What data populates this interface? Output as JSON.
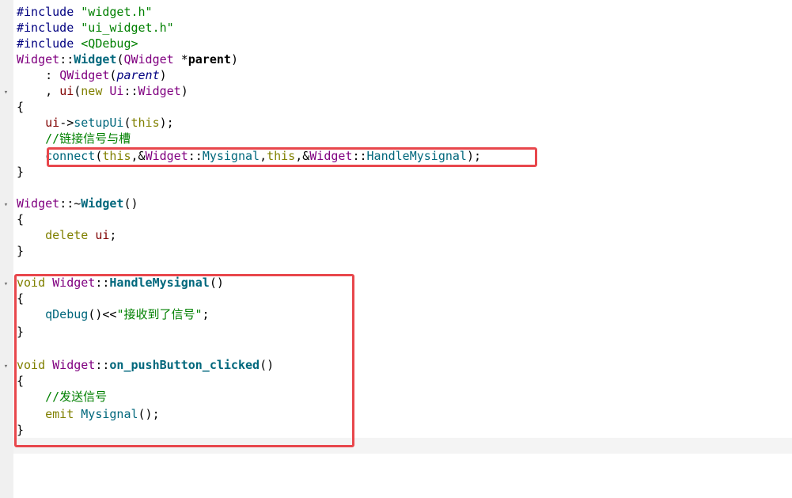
{
  "lines": [
    {
      "tokens": [
        {
          "t": "#include ",
          "c": "pp"
        },
        {
          "t": "\"widget.h\"",
          "c": "str"
        }
      ]
    },
    {
      "tokens": [
        {
          "t": "#include ",
          "c": "pp"
        },
        {
          "t": "\"ui_widget.h\"",
          "c": "str"
        }
      ]
    },
    {
      "tokens": [
        {
          "t": "#include ",
          "c": "pp"
        },
        {
          "t": "<QDebug>",
          "c": "str"
        }
      ]
    },
    {
      "tokens": [
        {
          "t": "Widget",
          "c": "cls"
        },
        {
          "t": "::",
          "c": "pl"
        },
        {
          "t": "Widget",
          "c": "fn"
        },
        {
          "t": "(",
          "c": "pl"
        },
        {
          "t": "QWidget",
          "c": "cls"
        },
        {
          "t": " *",
          "c": "pl"
        },
        {
          "t": "parent",
          "c": "bold"
        },
        {
          "t": ")",
          "c": "pl"
        }
      ]
    },
    {
      "tokens": [
        {
          "t": "    : ",
          "c": "pl"
        },
        {
          "t": "QWidget",
          "c": "cls"
        },
        {
          "t": "(",
          "c": "pl"
        },
        {
          "t": "parent",
          "c": "param"
        },
        {
          "t": ")",
          "c": "pl"
        }
      ]
    },
    {
      "fold": true,
      "tokens": [
        {
          "t": "    , ",
          "c": "pl"
        },
        {
          "t": "ui",
          "c": "mem"
        },
        {
          "t": "(",
          "c": "pl"
        },
        {
          "t": "new",
          "c": "kw"
        },
        {
          "t": " ",
          "c": "pl"
        },
        {
          "t": "Ui",
          "c": "cls"
        },
        {
          "t": "::",
          "c": "pl"
        },
        {
          "t": "Widget",
          "c": "cls"
        },
        {
          "t": ")",
          "c": "pl"
        }
      ]
    },
    {
      "tokens": [
        {
          "t": "{",
          "c": "pl"
        }
      ]
    },
    {
      "tokens": [
        {
          "t": "    ",
          "c": "pl"
        },
        {
          "t": "ui",
          "c": "mem"
        },
        {
          "t": "->",
          "c": "pl"
        },
        {
          "t": "setupUi",
          "c": "call"
        },
        {
          "t": "(",
          "c": "pl"
        },
        {
          "t": "this",
          "c": "kw"
        },
        {
          "t": ");",
          "c": "pl"
        }
      ]
    },
    {
      "tokens": [
        {
          "t": "    //链接信号与槽",
          "c": "cm"
        }
      ]
    },
    {
      "tokens": [
        {
          "t": "    ",
          "c": "pl"
        },
        {
          "t": "connect",
          "c": "call"
        },
        {
          "t": "(",
          "c": "pl"
        },
        {
          "t": "this",
          "c": "kw"
        },
        {
          "t": ",&",
          "c": "pl"
        },
        {
          "t": "Widget",
          "c": "cls"
        },
        {
          "t": "::",
          "c": "pl"
        },
        {
          "t": "Mysignal",
          "c": "call"
        },
        {
          "t": ",",
          "c": "pl"
        },
        {
          "t": "this",
          "c": "kw"
        },
        {
          "t": ",&",
          "c": "pl"
        },
        {
          "t": "Widget",
          "c": "cls"
        },
        {
          "t": "::",
          "c": "pl"
        },
        {
          "t": "HandleMysignal",
          "c": "call"
        },
        {
          "t": ");",
          "c": "pl"
        }
      ]
    },
    {
      "tokens": [
        {
          "t": "}",
          "c": "pl"
        }
      ]
    },
    {
      "tokens": []
    },
    {
      "fold": true,
      "tokens": [
        {
          "t": "Widget",
          "c": "cls"
        },
        {
          "t": "::~",
          "c": "pl"
        },
        {
          "t": "Widget",
          "c": "fn"
        },
        {
          "t": "()",
          "c": "pl"
        }
      ]
    },
    {
      "tokens": [
        {
          "t": "{",
          "c": "pl"
        }
      ]
    },
    {
      "tokens": [
        {
          "t": "    ",
          "c": "pl"
        },
        {
          "t": "delete",
          "c": "kw"
        },
        {
          "t": " ",
          "c": "pl"
        },
        {
          "t": "ui",
          "c": "mem"
        },
        {
          "t": ";",
          "c": "pl"
        }
      ]
    },
    {
      "tokens": [
        {
          "t": "}",
          "c": "pl"
        }
      ]
    },
    {
      "tokens": []
    },
    {
      "fold": true,
      "tokens": [
        {
          "t": "void",
          "c": "kw"
        },
        {
          "t": " ",
          "c": "pl"
        },
        {
          "t": "Widget",
          "c": "cls"
        },
        {
          "t": "::",
          "c": "pl"
        },
        {
          "t": "HandleMysignal",
          "c": "fn"
        },
        {
          "t": "()",
          "c": "pl"
        }
      ]
    },
    {
      "tokens": [
        {
          "t": "{",
          "c": "pl"
        }
      ]
    },
    {
      "tokens": [
        {
          "t": "    ",
          "c": "pl"
        },
        {
          "t": "qDebug",
          "c": "call"
        },
        {
          "t": "()<<",
          "c": "pl"
        },
        {
          "t": "\"接收到了信号\"",
          "c": "str"
        },
        {
          "t": ";",
          "c": "pl"
        }
      ]
    },
    {
      "tokens": [
        {
          "t": "}",
          "c": "pl"
        }
      ]
    },
    {
      "tokens": []
    },
    {
      "fold": true,
      "tokens": [
        {
          "t": "void",
          "c": "kw"
        },
        {
          "t": " ",
          "c": "pl"
        },
        {
          "t": "Widget",
          "c": "cls"
        },
        {
          "t": "::",
          "c": "pl"
        },
        {
          "t": "on_pushButton_clicked",
          "c": "fn"
        },
        {
          "t": "()",
          "c": "pl"
        }
      ]
    },
    {
      "tokens": [
        {
          "t": "{",
          "c": "pl"
        }
      ]
    },
    {
      "tokens": [
        {
          "t": "    //发送信号",
          "c": "cm"
        }
      ]
    },
    {
      "tokens": [
        {
          "t": "    ",
          "c": "pl"
        },
        {
          "t": "emit",
          "c": "kw"
        },
        {
          "t": " ",
          "c": "pl"
        },
        {
          "t": "Mysignal",
          "c": "call"
        },
        {
          "t": "();",
          "c": "pl"
        }
      ]
    },
    {
      "tokens": [
        {
          "t": "}",
          "c": "pl"
        }
      ]
    }
  ],
  "fold_marker": "▾",
  "highlight_color": "#e8474c"
}
